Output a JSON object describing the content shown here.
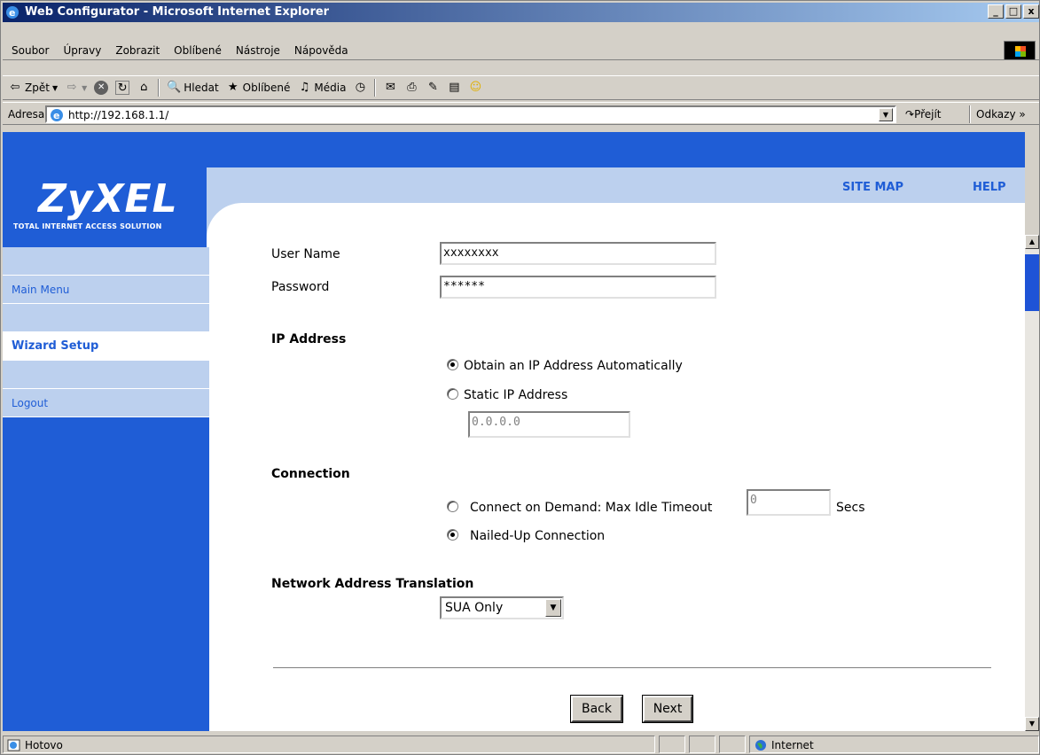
{
  "window": {
    "title": "Web Configurator - Microsoft Internet Explorer",
    "controls": [
      "_",
      "□",
      "x"
    ]
  },
  "menu": [
    "Soubor",
    "Úpravy",
    "Zobrazit",
    "Oblíbené",
    "Nástroje",
    "Nápověda"
  ],
  "toolbar": {
    "back": "Zpět",
    "search": "Hledat",
    "favorites": "Oblíbené",
    "media": "Média"
  },
  "address": {
    "label": "Adresa",
    "url": "http://192.168.1.1/",
    "go": "Přejít",
    "links": "Odkazy"
  },
  "brand": {
    "logo": "ZyXEL",
    "tagline": "TOTAL INTERNET ACCESS SOLUTION"
  },
  "header": {
    "site_map": "SITE MAP",
    "help": "HELP"
  },
  "sidebar": [
    {
      "label": "Main Menu",
      "active": false
    },
    {
      "label": "Wizard Setup",
      "active": true
    },
    {
      "label": "Logout",
      "active": false
    }
  ],
  "form": {
    "user_name_label": "User Name",
    "user_name_value": "xxxxxxxx",
    "password_label": "Password",
    "password_value": "******",
    "ip_section": "IP Address",
    "ip_auto_label": "Obtain an IP Address Automatically",
    "ip_static_label": "Static IP Address",
    "ip_static_value": "0.0.0.0",
    "ip_mode": "auto",
    "connection_section": "Connection",
    "demand_label": "Connect on Demand: Max Idle Timeout",
    "demand_value": "0",
    "demand_unit": "Secs",
    "nailed_label": "Nailed-Up Connection",
    "connection_mode": "nailed-up",
    "nat_section": "Network Address Translation",
    "nat_value": "SUA Only",
    "back_button": "Back",
    "next_button": "Next"
  },
  "status": {
    "text": "Hotovo",
    "zone": "Internet"
  },
  "colors": {
    "zyxel_blue": "#1f5dd6",
    "light_blue": "#bcd0ee"
  }
}
